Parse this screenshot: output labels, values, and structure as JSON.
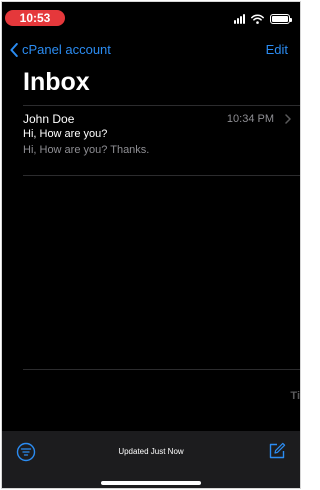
{
  "status_bar": {
    "time": "10:53",
    "icons": [
      "cellular-signal-icon",
      "wifi-icon",
      "battery-icon"
    ]
  },
  "nav": {
    "back_label": "cPanel account",
    "edit_label": "Edit"
  },
  "title": "Inbox",
  "messages": [
    {
      "sender": "John Doe",
      "time": "10:34 PM",
      "subject": "Hi, How are you?",
      "preview": "Hi, How are you? Thanks."
    }
  ],
  "edge_glyph": "Ti",
  "toolbar": {
    "status": "Updated Just Now",
    "icons": [
      "filter-icon",
      "compose-icon"
    ]
  },
  "colors": {
    "background": "#000000",
    "accent": "#2b8cf2",
    "time_pill": "#e5383b",
    "secondary_text": "#8e8e93",
    "toolbar": "#1c1c1e"
  }
}
